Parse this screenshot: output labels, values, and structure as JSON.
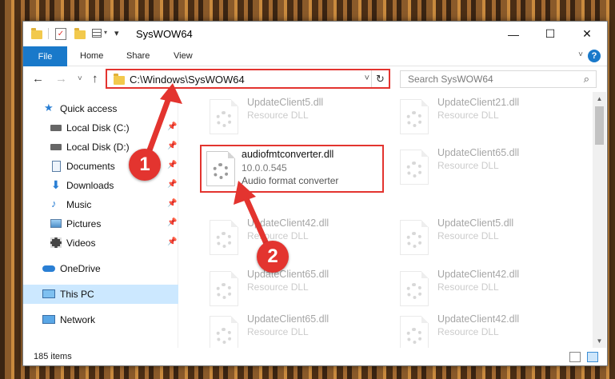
{
  "window": {
    "title": "SysWOW64",
    "controls": {
      "minimize": "—",
      "maximize": "☐",
      "close": "✕"
    }
  },
  "ribbon": {
    "file": "File",
    "tabs": [
      "Home",
      "Share",
      "View"
    ],
    "help": "?",
    "collapse": "˅"
  },
  "nav": {
    "back": "←",
    "forward": "→",
    "recent": "˅",
    "up": "↑",
    "address": "C:\\Windows\\SysWOW64",
    "address_dropdown": "˅",
    "refresh": "↻",
    "search_placeholder": "Search SysWOW64",
    "search_icon": "⌕"
  },
  "sidebar": {
    "items": [
      {
        "label": "Quick access",
        "icon": "star-icon",
        "pinned": false
      },
      {
        "label": "Local Disk (C:)",
        "icon": "drive-icon",
        "pinned": true
      },
      {
        "label": "Local Disk (D:)",
        "icon": "drive-icon",
        "pinned": true
      },
      {
        "label": "Documents",
        "icon": "documents-icon",
        "pinned": true
      },
      {
        "label": "Downloads",
        "icon": "download-icon",
        "pinned": true
      },
      {
        "label": "Music",
        "icon": "music-icon",
        "pinned": true
      },
      {
        "label": "Pictures",
        "icon": "pictures-icon",
        "pinned": true
      },
      {
        "label": "Videos",
        "icon": "videos-icon",
        "pinned": true
      },
      {
        "label": "OneDrive",
        "icon": "cloud-icon",
        "pinned": false
      },
      {
        "label": "This PC",
        "icon": "computer-icon",
        "pinned": false
      },
      {
        "label": "Network",
        "icon": "network-icon",
        "pinned": false
      }
    ],
    "pin_glyph": "📌"
  },
  "files": [
    {
      "name": "UpdateClient5.dll",
      "desc": "Resource DLL",
      "version": ""
    },
    {
      "name": "UpdateClient21.dll",
      "desc": "Resource DLL",
      "version": ""
    },
    {
      "name": "audiofmtconverter.dll",
      "version": "10.0.0.545",
      "desc": "Audio format converter"
    },
    {
      "name": "UpdateClient65.dll",
      "desc": "Resource DLL",
      "version": ""
    },
    {
      "name": "UpdateClient42.dll",
      "desc": "Resource DLL",
      "version": ""
    },
    {
      "name": "UpdateClient5.dll",
      "desc": "Resource DLL",
      "version": ""
    },
    {
      "name": "UpdateClient65.dll",
      "desc": "Resource DLL",
      "version": ""
    },
    {
      "name": "UpdateClient42.dll",
      "desc": "Resource DLL",
      "version": ""
    },
    {
      "name": "UpdateClient65.dll",
      "desc": "Resource DLL",
      "version": ""
    },
    {
      "name": "UpdateClient42.dll",
      "desc": "Resource DLL",
      "version": ""
    }
  ],
  "status": {
    "items": "185 items"
  },
  "annotations": {
    "step1": "1",
    "step2": "2"
  },
  "colors": {
    "accent": "#1979ca",
    "highlight": "#e3342f",
    "selected": "#cce8ff"
  }
}
